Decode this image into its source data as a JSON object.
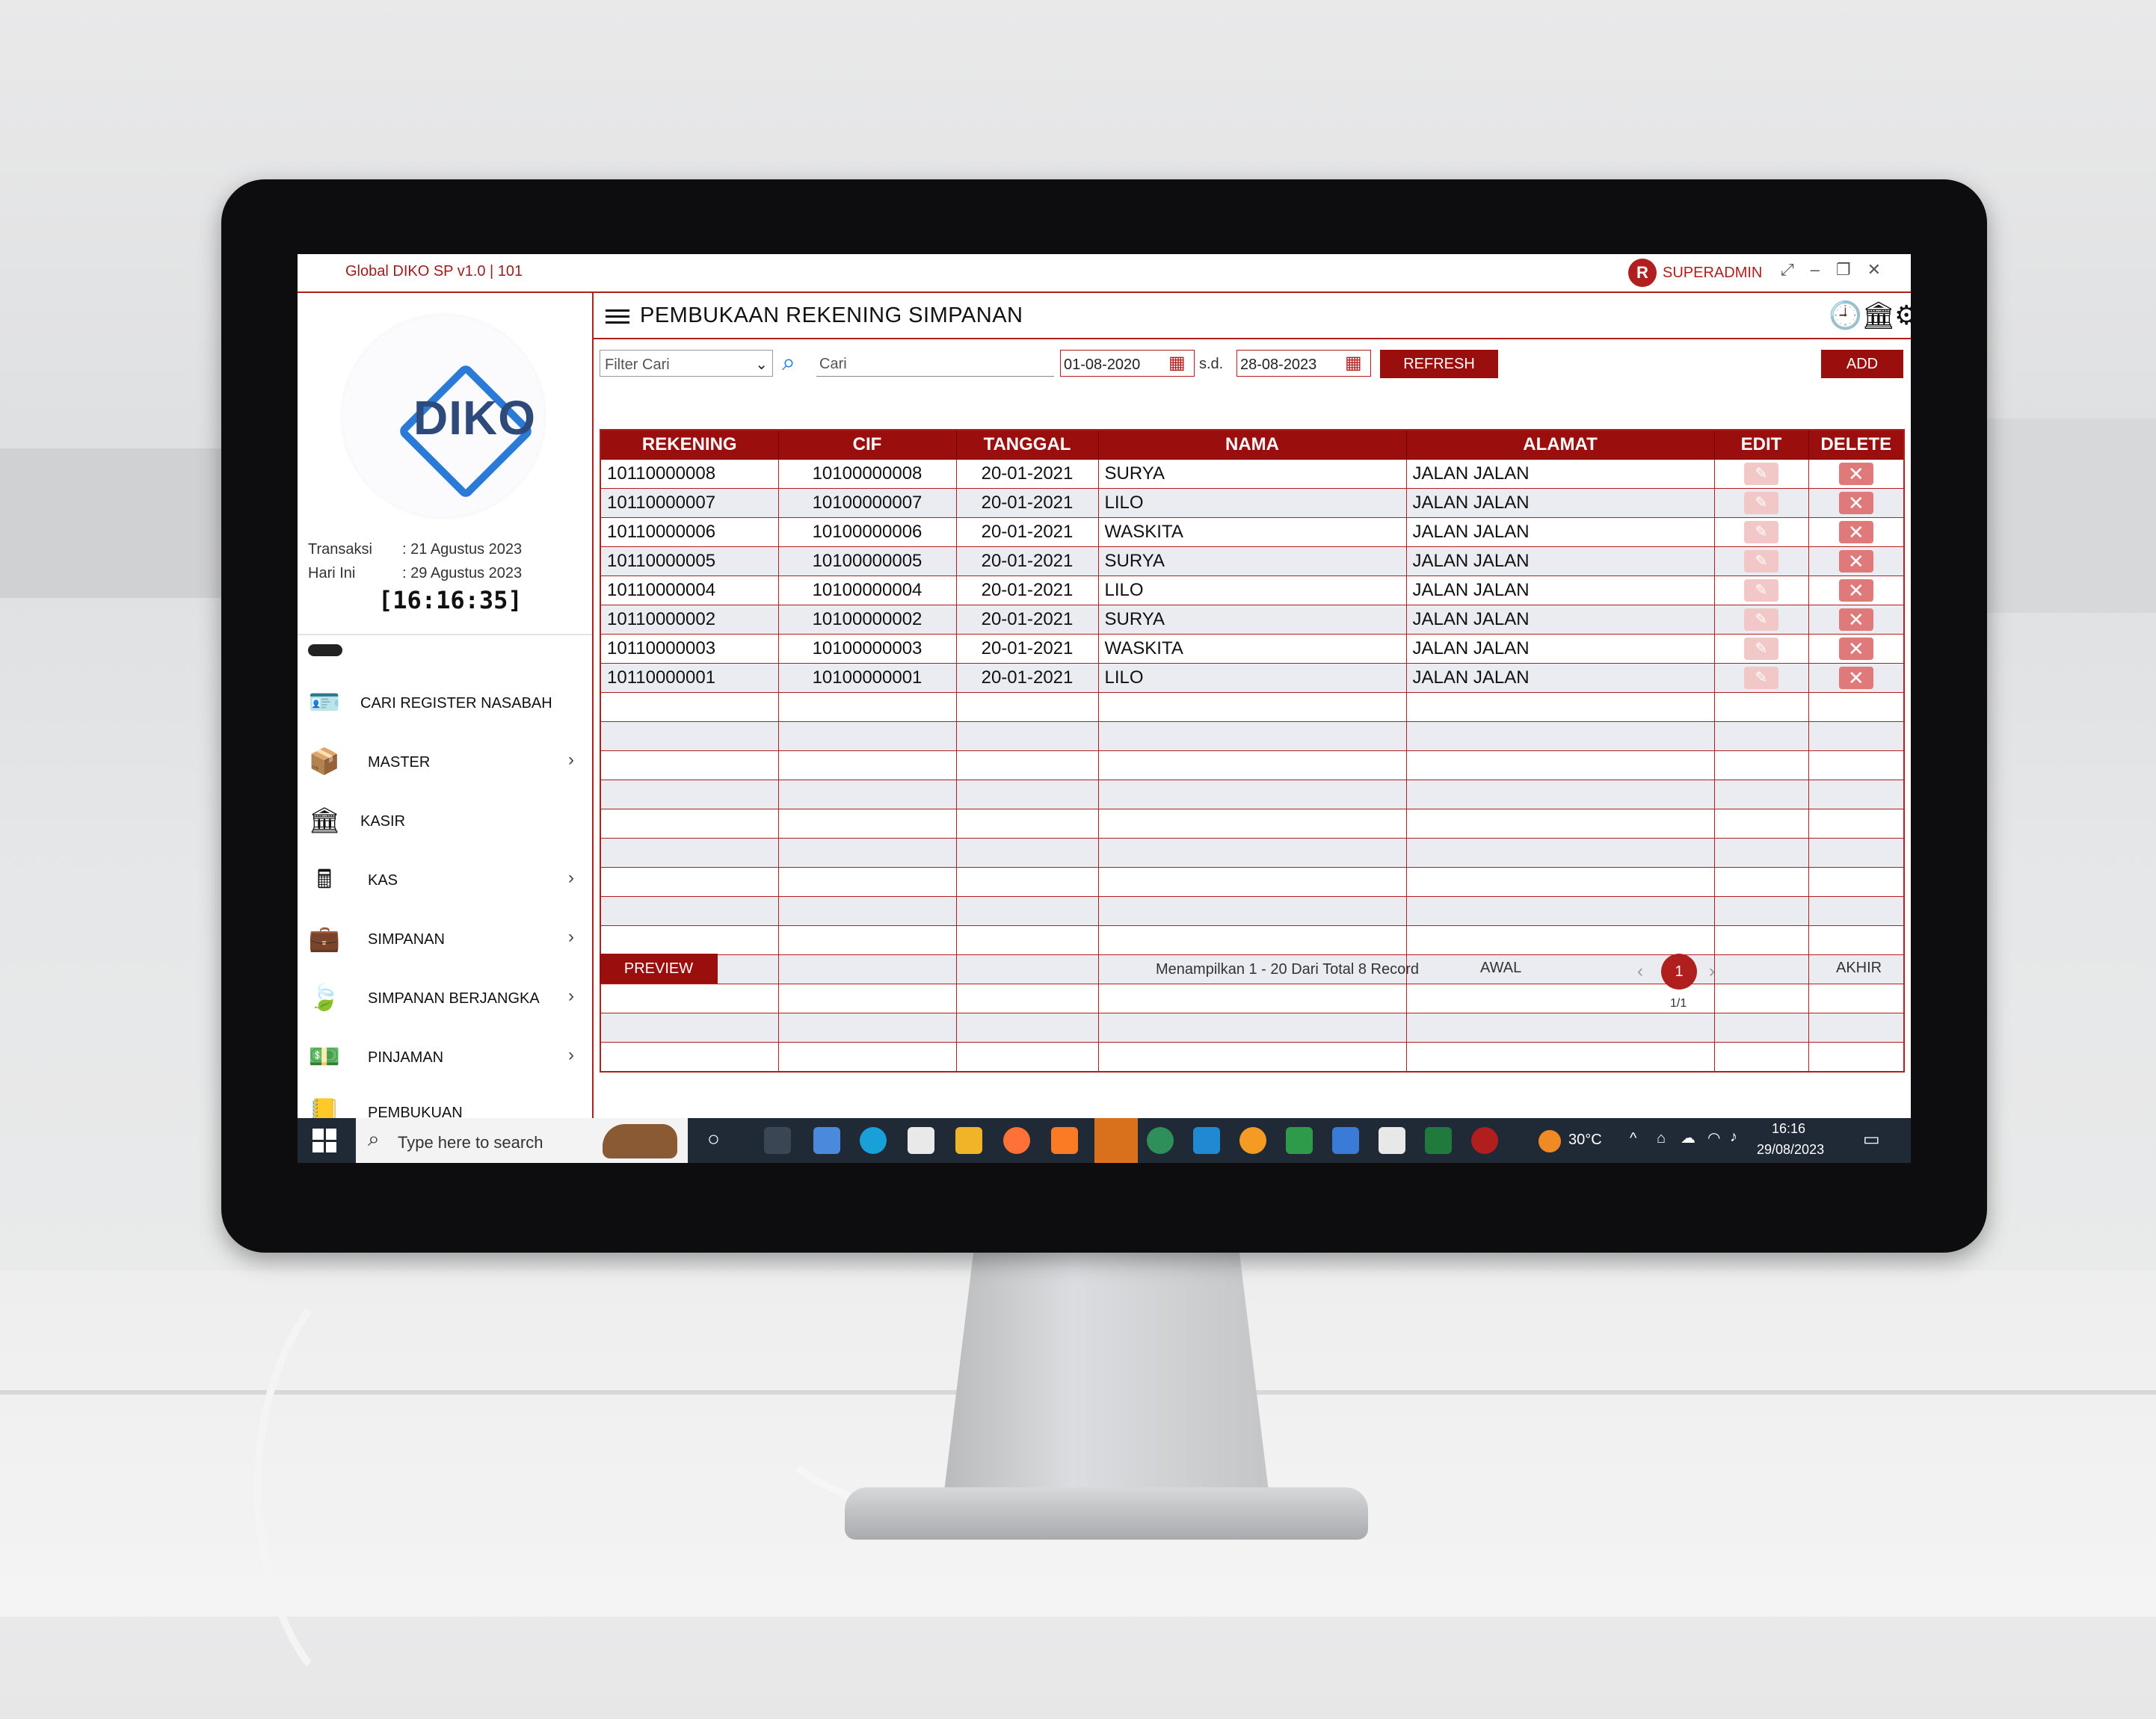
{
  "app": {
    "title": "Global DIKO SP v1.0 | 101",
    "user": "SUPERADMIN",
    "logo_text": "DIKO"
  },
  "sidebar": {
    "transaksi_label": "Transaksi",
    "transaksi_value": ": 21 Agustus 2023",
    "hari_ini_label": "Hari Ini",
    "hari_ini_value": ": 29 Agustus 2023",
    "clock": "[16:16:35]",
    "items": [
      {
        "label": "CARI REGISTER NASABAH",
        "icon": "id-card-icon",
        "arrow": ""
      },
      {
        "label": "MASTER",
        "icon": "box-icon",
        "arrow": "›"
      },
      {
        "label": "KASIR",
        "icon": "bank-icon",
        "arrow": ""
      },
      {
        "label": "KAS",
        "icon": "calculator-icon",
        "arrow": "›"
      },
      {
        "label": "SIMPANAN",
        "icon": "briefcase-icon",
        "arrow": "›"
      },
      {
        "label": "SIMPANAN BERJANGKA",
        "icon": "leaf-icon",
        "arrow": "›"
      },
      {
        "label": "PINJAMAN",
        "icon": "money-hand-icon",
        "arrow": "›"
      },
      {
        "label": "PEMBUKUAN",
        "icon": "book-icon",
        "arrow": ""
      }
    ]
  },
  "header": {
    "title": "PEMBUKAAN REKENING SIMPANAN"
  },
  "toolbar": {
    "filter_placeholder": "Filter Cari",
    "search_placeholder": "Cari",
    "date_from": "01-08-2020",
    "sd_label": "s.d.",
    "date_to": "28-08-2023",
    "refresh_label": "REFRESH",
    "add_label": "ADD"
  },
  "table": {
    "columns": [
      "REKENING",
      "CIF",
      "TANGGAL",
      "NAMA",
      "ALAMAT",
      "EDIT",
      "DELETE"
    ],
    "rows": [
      {
        "rekening": "10110000008",
        "cif": "10100000008",
        "tanggal": "20-01-2021",
        "nama": "SURYA",
        "alamat": "JALAN JALAN"
      },
      {
        "rekening": "10110000007",
        "cif": "10100000007",
        "tanggal": "20-01-2021",
        "nama": "LILO",
        "alamat": "JALAN JALAN"
      },
      {
        "rekening": "10110000006",
        "cif": "10100000006",
        "tanggal": "20-01-2021",
        "nama": "WASKITA",
        "alamat": "JALAN JALAN"
      },
      {
        "rekening": "10110000005",
        "cif": "10100000005",
        "tanggal": "20-01-2021",
        "nama": "SURYA",
        "alamat": "JALAN JALAN"
      },
      {
        "rekening": "10110000004",
        "cif": "10100000004",
        "tanggal": "20-01-2021",
        "nama": "LILO",
        "alamat": "JALAN JALAN"
      },
      {
        "rekening": "10110000002",
        "cif": "10100000002",
        "tanggal": "20-01-2021",
        "nama": "SURYA",
        "alamat": "JALAN JALAN"
      },
      {
        "rekening": "10110000003",
        "cif": "10100000003",
        "tanggal": "20-01-2021",
        "nama": "WASKITA",
        "alamat": "JALAN JALAN"
      },
      {
        "rekening": "10110000001",
        "cif": "10100000001",
        "tanggal": "20-01-2021",
        "nama": "LILO",
        "alamat": "JALAN JALAN"
      }
    ],
    "empty_rows": 13
  },
  "footer": {
    "preview_label": "PREVIEW",
    "record_info": "Menampilkan 1 - 20 Dari Total 8 Record",
    "first_label": "AWAL",
    "last_label": "AKHIR",
    "current_page": "1",
    "page_of": "1/1"
  },
  "taskbar": {
    "search_placeholder": "Type here to search",
    "weather": "30°C",
    "time": "16:16",
    "date": "29/08/2023"
  },
  "colors": {
    "accent": "#9b0e0e",
    "accent_light": "#b01e1e",
    "row_alt": "#eaecf1",
    "logo_blue": "#2a7ad8"
  }
}
